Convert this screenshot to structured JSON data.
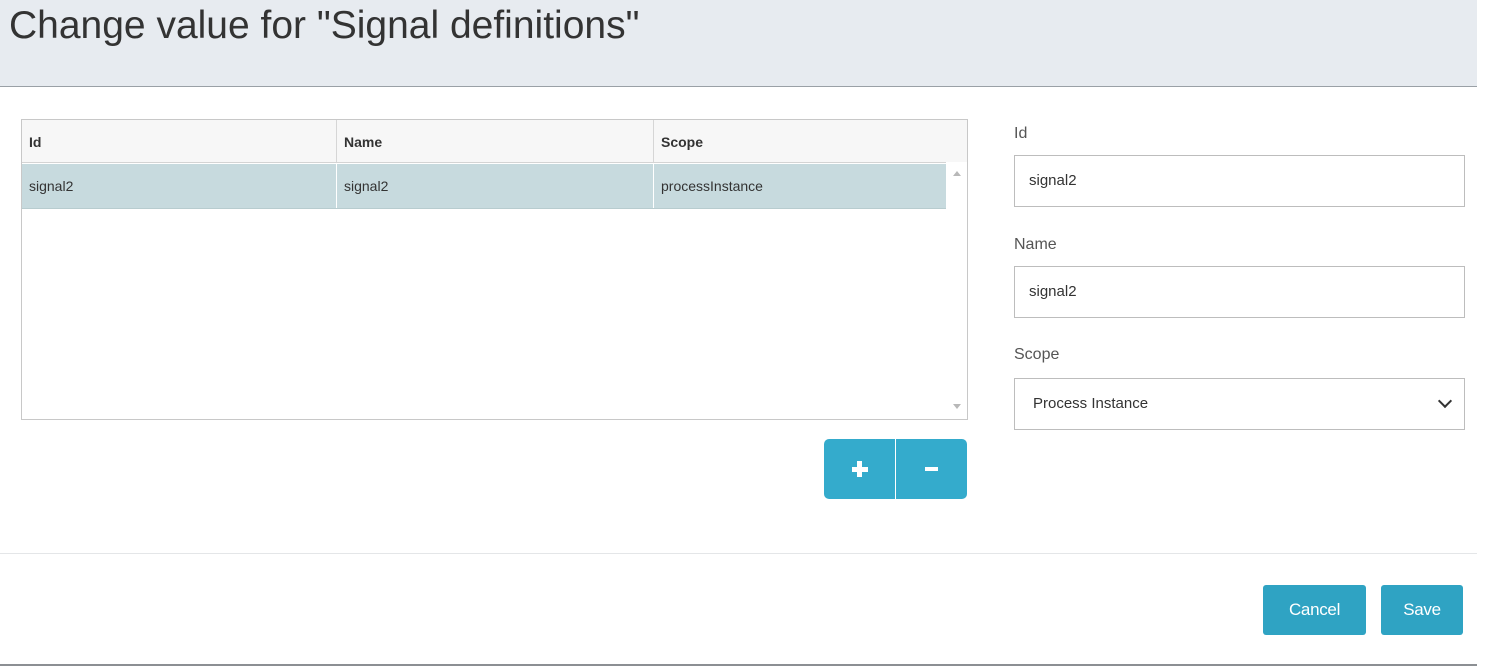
{
  "dialog": {
    "title": "Change value for \"Signal definitions\""
  },
  "grid": {
    "columns": [
      "Id",
      "Name",
      "Scope"
    ],
    "rows": [
      {
        "id": "signal2",
        "name": "signal2",
        "scope": "processInstance"
      }
    ]
  },
  "toolbar": {
    "add_icon": "plus-icon",
    "remove_icon": "minus-icon"
  },
  "form": {
    "id_label": "Id",
    "id_value": "signal2",
    "name_label": "Name",
    "name_value": "signal2",
    "scope_label": "Scope",
    "scope_value": "Process Instance"
  },
  "footer": {
    "cancel_label": "Cancel",
    "save_label": "Save"
  },
  "colors": {
    "accent": "#2fa3c3",
    "selected_row": "#c7dade",
    "header_bg": "#e7ebf0"
  }
}
